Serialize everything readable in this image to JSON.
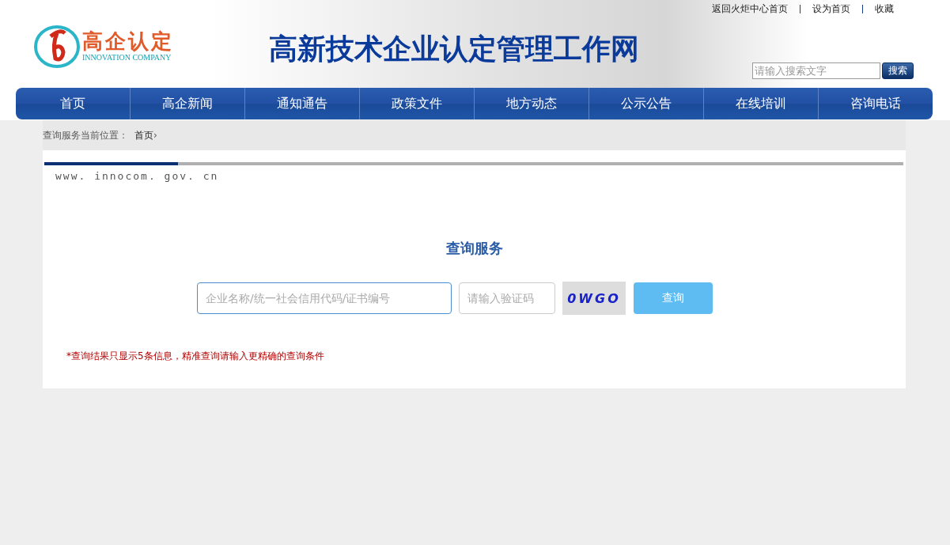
{
  "top_links": [
    "返回火炬中心首页",
    "设为首页",
    "收藏"
  ],
  "logo": {
    "title": "高企认定",
    "subtitle": "INNOVATION COMPANY"
  },
  "site_title": "高新技术企业认定管理工作网",
  "search": {
    "placeholder": "请输入搜索文字",
    "button": "搜索"
  },
  "nav": [
    "首页",
    "高企新闻",
    "通知通告",
    "政策文件",
    "地方动态",
    "公示公告",
    "在线培训",
    "咨询电话"
  ],
  "breadcrumb": {
    "label": "查询服务当前位置：",
    "items": [
      "首页"
    ],
    "separator": "›"
  },
  "url_text": "www. innocom. gov. cn",
  "query": {
    "title": "查询服务",
    "company_placeholder": "企业名称/统一社会信用代码/证书编号",
    "captcha_placeholder": "请输入验证码",
    "captcha": "0WGO",
    "button": "查询",
    "note": "*查询结果只显示5条信息，精准查询请输入更精确的查询条件"
  }
}
